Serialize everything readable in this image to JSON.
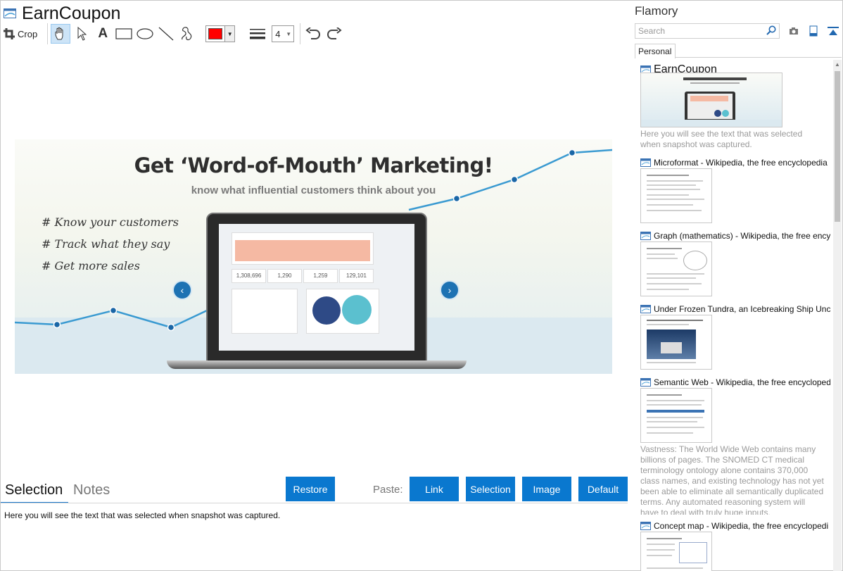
{
  "window": {
    "title": "EarnCoupon"
  },
  "toolbar": {
    "crop_label": "Crop",
    "tools": [
      "hand-tool",
      "pointer-tool",
      "text-tool",
      "rectangle-tool",
      "ellipse-tool",
      "line-tool",
      "freehand-tool"
    ],
    "color": "#ff0000",
    "line_width": "4"
  },
  "snapshot": {
    "headline": "Get ‘Word-of-Mouth’ Marketing!",
    "subheadline": "know what influential customers think about you",
    "bullets": [
      "#  Know your customers",
      "#  Track what they say",
      "#  Get more sales"
    ],
    "stats": [
      "1,308,696",
      "1,290",
      "1,259",
      "129,101"
    ]
  },
  "bottom": {
    "tabs": {
      "selection": "Selection",
      "notes": "Notes"
    },
    "restore_label": "Restore",
    "paste_label": "Paste:",
    "paste_buttons": {
      "link": "Link",
      "selection": "Selection",
      "image": "Image",
      "default": "Default"
    },
    "selection_text": "Here you will see the text that was selected when snapshot was captured."
  },
  "flamory": {
    "title": "Flamory",
    "search_placeholder": "Search",
    "tab": "Personal",
    "items": [
      {
        "title": "EarnCoupon",
        "desc": "Here you will see the text that was selected when snapshot was captured."
      },
      {
        "title": "Microformat - Wikipedia, the free encyclopedia"
      },
      {
        "title": "Graph (mathematics) - Wikipedia, the free ency"
      },
      {
        "title": "Under Frozen Tundra, an Icebreaking Ship Unco"
      },
      {
        "title": "Semantic Web - Wikipedia, the free encycloped",
        "desc": "Vastness: The World Wide Web contains many billions of pages. The SNOMED CT medical terminology ontology alone contains 370,000 class names, and existing technology has not yet been able to eliminate all semantically duplicated terms. Any automated reasoning system will have to deal with truly huge inputs."
      },
      {
        "title": "Concept map - Wikipedia, the free encyclopedi"
      }
    ]
  },
  "colors": {
    "accent": "#0a78cf",
    "tab_underline": "#1a76c9",
    "trend_line": "#3a9ad1",
    "trend_point": "#1a66a6"
  }
}
